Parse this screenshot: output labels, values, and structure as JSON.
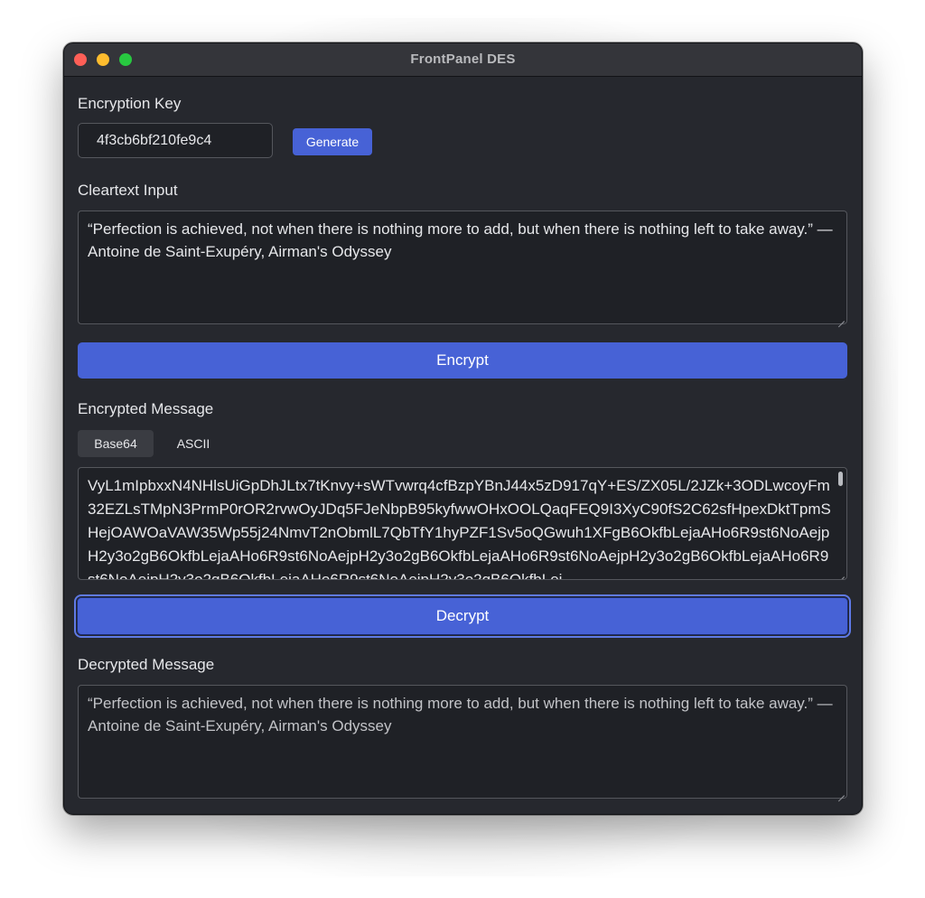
{
  "window": {
    "title": "FrontPanel DES"
  },
  "key_section": {
    "label": "Encryption Key",
    "value": "4f3cb6bf210fe9c4",
    "generate_label": "Generate"
  },
  "cleartext_section": {
    "label": "Cleartext Input",
    "value": "“Perfection is achieved, not when there is nothing more to add, but when there is nothing left to take away.” — Antoine de Saint-Exupéry, Airman's Odyssey",
    "encrypt_label": "Encrypt"
  },
  "encrypted_section": {
    "label": "Encrypted Message",
    "tabs": [
      "Base64",
      "ASCII"
    ],
    "active_tab": "Base64",
    "value": "VyL1mIpbxxN4NHlsUiGpDhJLtx7tKnvy+sWTvwrq4cfBzpYBnJ44x5zD917qY+ES/ZX05L/2JZk+3ODLwcoyFm32EZLsTMpN3PrmP0rOR2rvwOyJDq5FJeNbpB95kyfwwOHxOOLQaqFEQ9I3XyC90fS2C62sfHpexDktTpmSHejOAWOaVAW35Wp55j24NmvT2nObmlL7QbTfY1hyPZF1Sv5oQGwuh1XFgB6OkfbLejaAHo6R9st6NoAejpH2y3o2gB6OkfbLejaAHo6R9st6NoAejpH2y3o2gB6OkfbLejaAHo6R9st6NoAejpH2y3o2gB6OkfbLejaAHo6R9st6NoAejpH2y3o2gB6OkfbLejaAHo6R9st6NoAejpH2y3o2gB6OkfbLej",
    "decrypt_label": "Decrypt"
  },
  "decrypted_section": {
    "label": "Decrypted Message",
    "value": "“Perfection is achieved, not when there is nothing more to add, but when there is nothing left to take away.” — Antoine de Saint-Exupéry, Airman's Odyssey"
  },
  "colors": {
    "accent": "#4762d6",
    "window_bg": "#26282e",
    "field_bg": "#1f2126"
  }
}
